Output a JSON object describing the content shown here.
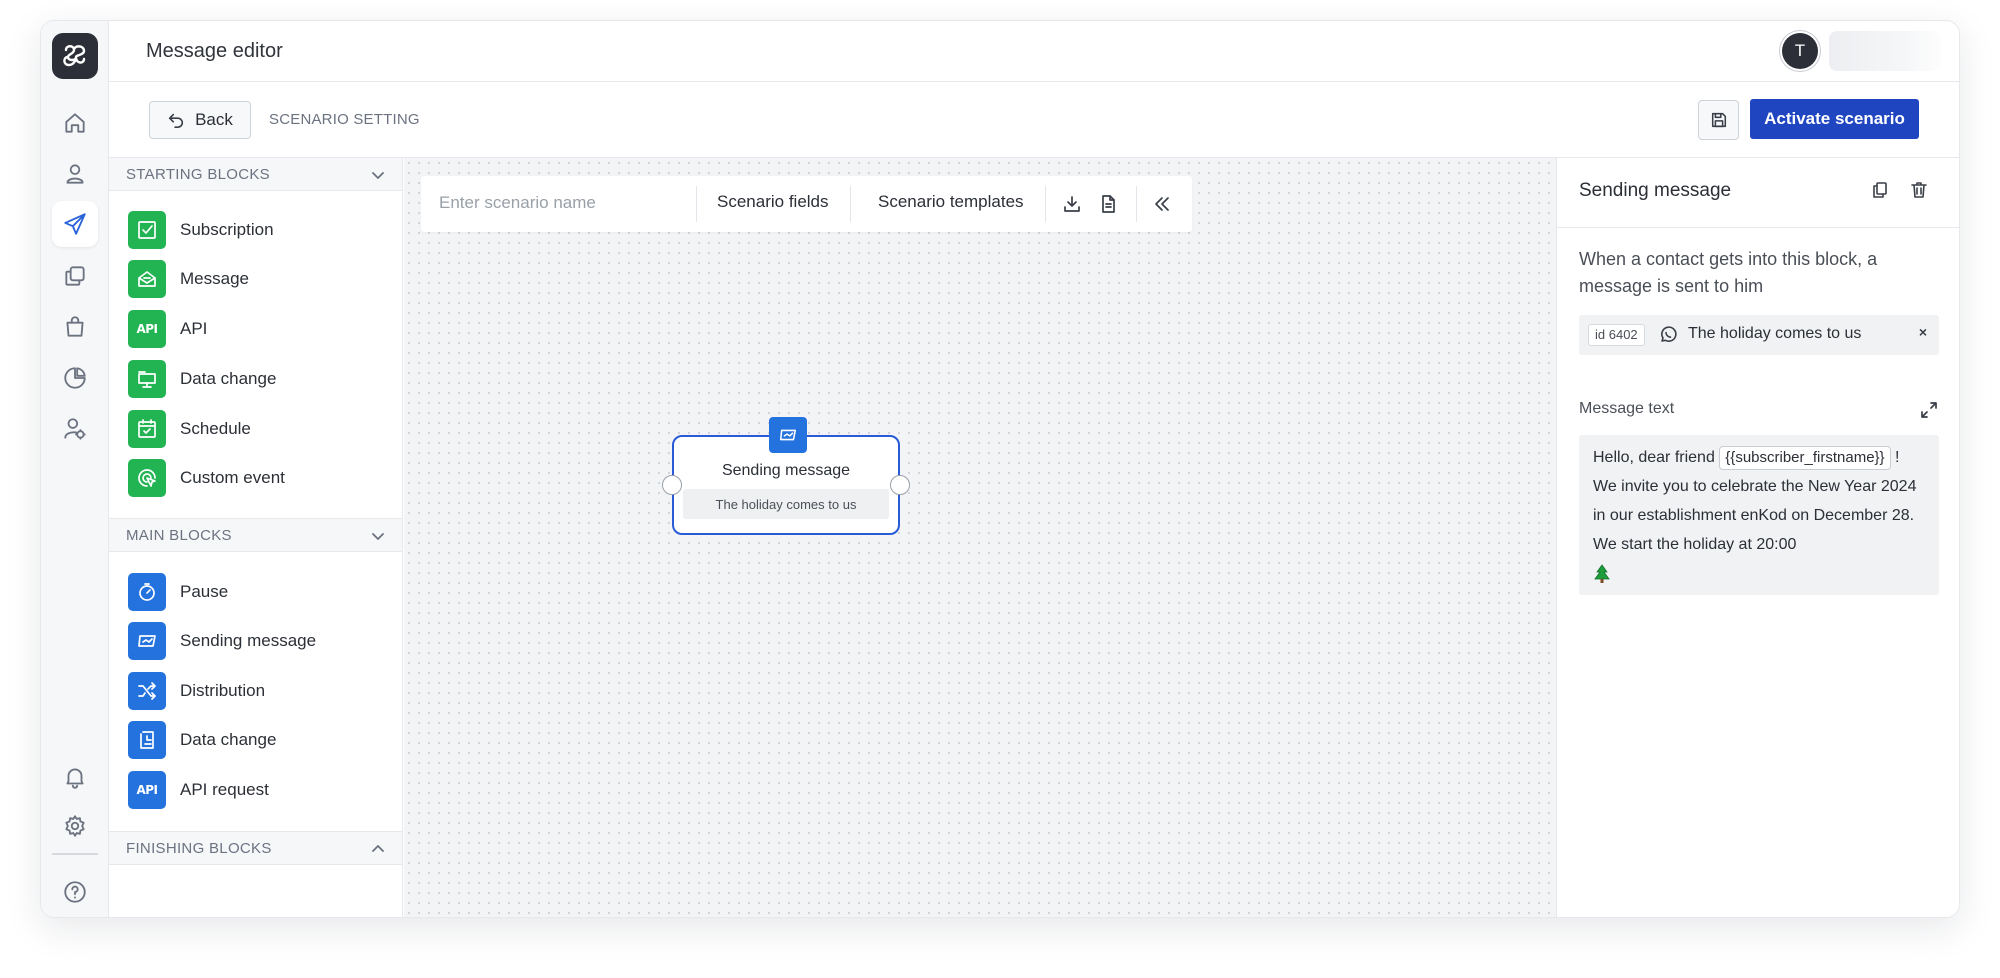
{
  "app": {
    "title": "Message editor",
    "user_initial": "T"
  },
  "nav": {
    "items": [
      "home-icon",
      "contacts-icon",
      "send-icon",
      "templates-icon",
      "shop-icon",
      "analytics-icon",
      "user-settings-icon"
    ],
    "active": "send-icon",
    "bottom": [
      "bell-icon",
      "gear-icon",
      "help-icon"
    ]
  },
  "subbar": {
    "back_label": "Back",
    "breadcrumb": "SCENARIO SETTING",
    "activate_label": "Activate scenario"
  },
  "blocks": {
    "starting": {
      "label": "STARTING BLOCKS",
      "items": [
        {
          "label": "Subscription",
          "icon": "subscription-icon"
        },
        {
          "label": "Message",
          "icon": "message-icon"
        },
        {
          "label": "API",
          "icon": "api-icon"
        },
        {
          "label": "Data change",
          "icon": "data-change-icon"
        },
        {
          "label": "Schedule",
          "icon": "schedule-icon"
        },
        {
          "label": "Custom event",
          "icon": "custom-event-icon"
        }
      ]
    },
    "main": {
      "label": "MAIN BLOCKS",
      "items": [
        {
          "label": "Pause",
          "icon": "pause-icon"
        },
        {
          "label": "Sending message",
          "icon": "sending-message-icon"
        },
        {
          "label": "Distribution",
          "icon": "distribution-icon"
        },
        {
          "label": "Data change",
          "icon": "data-change-icon"
        },
        {
          "label": "API request",
          "icon": "api-request-icon"
        }
      ]
    },
    "finishing": {
      "label": "FINISHING BLOCKS"
    },
    "colors": {
      "starting": "#22b453",
      "main": "#2472de"
    },
    "api_icon_text": "API"
  },
  "toolbar": {
    "name_placeholder": "Enter scenario name",
    "fields_label": "Scenario fields",
    "templates_label": "Scenario templates"
  },
  "node": {
    "title": "Sending message",
    "subtitle": "The holiday comes to us"
  },
  "props": {
    "title": "Sending message",
    "description": "When a contact gets into this block, a message is sent to him",
    "message": {
      "id": "id 6402",
      "channel_icon": "whatsapp-icon",
      "title": "The holiday comes to us",
      "close": "×"
    },
    "message_text_label": "Message text",
    "message_text": {
      "before": "Hello, dear friend ",
      "variable": "{{subscriber_firstname}}",
      "after": " ! We invite you to celebrate the New Year 2024 in our establishment enKod on December 28. We start the holiday at 20:00"
    }
  },
  "colors": {
    "accent": "#1f45c0",
    "node_border": "#2a5bd7"
  }
}
